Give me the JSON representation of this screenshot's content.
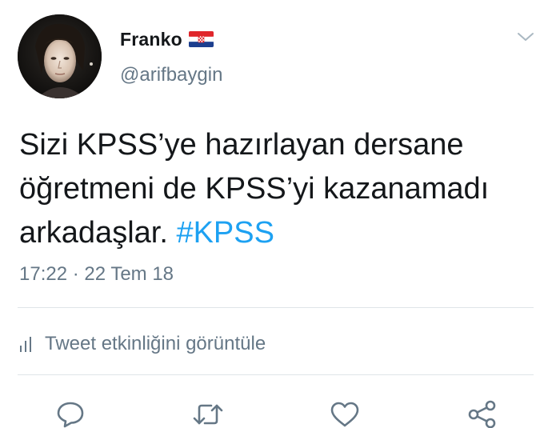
{
  "user": {
    "name": "Franko",
    "handle": "@arifbaygin",
    "avatar_icon": "user-photo",
    "flag_icon": "croatia-flag"
  },
  "tweet": {
    "text_line1": "Sizi KPSS’ye hazırlayan dersane",
    "text_line2": "öğretmeni de KPSS’yi kazanamadı",
    "text_line3": "arkadaşlar.",
    "hashtag": "#KPSS",
    "timestamp": "17:22 · 22 Tem 18"
  },
  "activity": {
    "label": "Tweet etkinliğini görüntüle",
    "icon": "bar-chart-icon"
  },
  "actions": [
    {
      "name": "reply",
      "icon": "speech-bubble-icon"
    },
    {
      "name": "retweet",
      "icon": "retweet-icon"
    },
    {
      "name": "like",
      "icon": "heart-icon"
    },
    {
      "name": "share",
      "icon": "share-icon"
    }
  ],
  "colors": {
    "text": "#14171a",
    "secondary": "#657786",
    "hashtag": "#1da1f2",
    "divider": "#dfe4e8"
  }
}
